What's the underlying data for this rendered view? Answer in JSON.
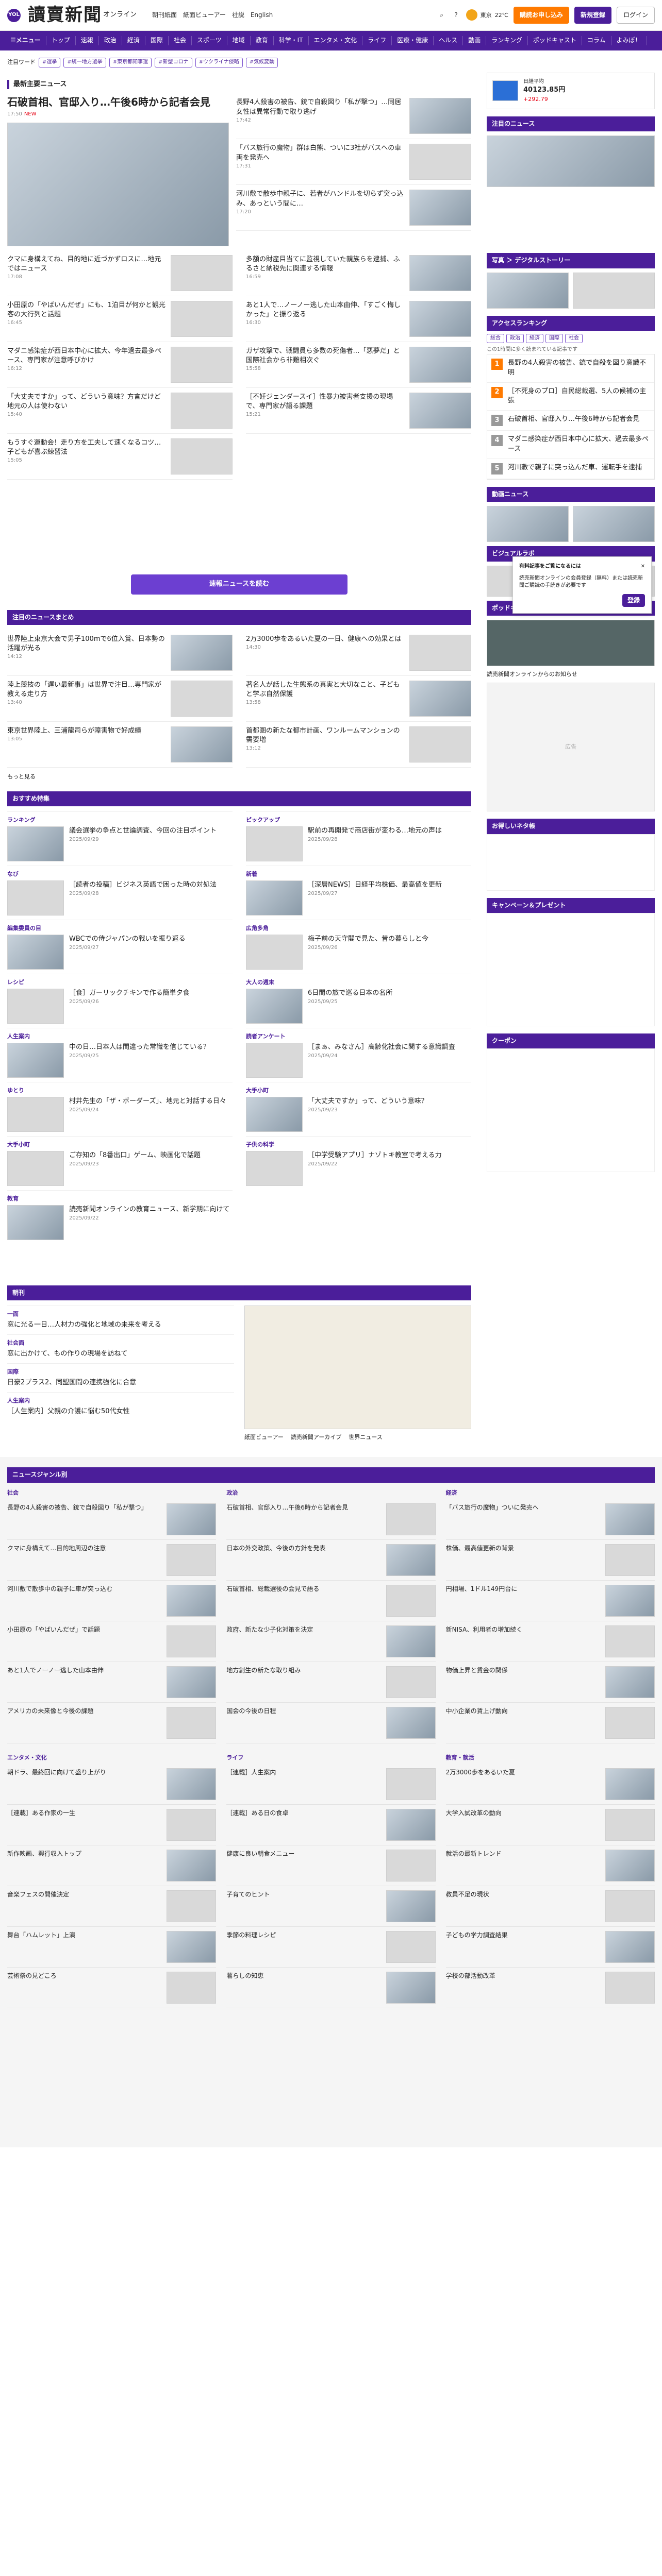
{
  "header": {
    "brand_badge": "YOL",
    "logo": "讀賣新聞",
    "logo_sub": "オンライン",
    "links": [
      "朝刊紙面",
      "紙面ビューアー",
      "社説",
      "English"
    ],
    "weather": {
      "city": "東京",
      "temp": "22℃"
    },
    "btn_subscribe": "購読お申し込み",
    "btn_register": "新規登録",
    "btn_login": "ログイン"
  },
  "nav": {
    "items": [
      "☰メニュー",
      "トップ",
      "速報",
      "政治",
      "経済",
      "国際",
      "社会",
      "スポーツ",
      "地域",
      "教育",
      "科学・IT",
      "エンタメ・文化",
      "ライフ",
      "医療・健康",
      "ヘルス",
      "動画",
      "ランキング",
      "ポッドキャスト",
      "コラム",
      "よみぽ！"
    ]
  },
  "trend": {
    "label": "注目ワード",
    "tags": [
      "#選挙",
      "#統一地方選挙",
      "#東京都知事選",
      "#新型コロナ",
      "#ウクライナ侵略",
      "#気候変動"
    ]
  },
  "main": {
    "section_title": "最新主要ニュース",
    "lead": {
      "title": "石破首相、官邸入り…午後6時から記者会見",
      "meta": "17:50",
      "new": "NEW"
    },
    "news": [
      {
        "title": "長野4人殺害の被告、銃で自殺図り「私が撃つ」…同居女性は異常行動で取り逃げ",
        "meta": "17:42"
      },
      {
        "title": "「バス旅行の魔物」群は白熊、ついに3社がバスへの車両を発売へ",
        "meta": "17:31"
      },
      {
        "title": "河川敷で散歩中親子に、若者がハンドルを切らず突っ込み、あっという間に…",
        "meta": "17:20"
      },
      {
        "title": "クマに身構えてね、目的地に近づかずロスに…地元ではニュース",
        "meta": "17:08"
      },
      {
        "title": "多額の財産目当てに監視していた親族らを逮捕、ふるさと納税先に関連する情報",
        "meta": "16:59"
      },
      {
        "title": "小田原の「やばいんだぜ」にも、1泊目が何かと観光客の大行列と話題",
        "meta": "16:45"
      },
      {
        "title": "あと1人で…ノーノー逃した山本由伸、「すごく悔しかった」と振り返る",
        "meta": "16:30"
      },
      {
        "title": "マダニ感染症が西日本中心に拡大、今年過去最多ペース、専門家が注意呼びかけ",
        "meta": "16:12"
      },
      {
        "title": "ガザ攻撃で、戦闘員ら多数の死傷者…「悪夢だ」と国際社会から非難相次ぐ",
        "meta": "15:58"
      },
      {
        "title": "「大丈夫ですか」って、どういう意味？方言だけど地元の人は使わない",
        "meta": "15:40"
      },
      {
        "title": "［不妊ジェンダースイ］性暴力被害者支援の現場で、専門家が語る課題",
        "meta": "15:21"
      },
      {
        "title": "もうすぐ運動会！走り方を工夫して速くなるコツ…子どもが喜ぶ練習法",
        "meta": "15:05"
      }
    ],
    "more_button": "速報ニュースを読む",
    "today_title": "注目のニュースまとめ",
    "today_left": [
      {
        "title": "世界陸上東京大会で男子100mで6位入賞、日本勢の活躍が光る",
        "meta": "14:12"
      },
      {
        "title": "陸上競技の「遅い最新事」は世界で注目…専門家が教える走り方",
        "meta": "13:40"
      },
      {
        "title": "東京世界陸上、三浦龍司らが障害物で好成績",
        "meta": "13:05"
      }
    ],
    "today_right": [
      {
        "title": "2万3000歩をあるいた夏の一日、健康への効果とは",
        "meta": "14:30"
      },
      {
        "title": "著名人が話した生態系の真実と大切なこと、子どもと学ぶ自然保護",
        "meta": "13:58"
      },
      {
        "title": "首都圏の新たな都市計画、ワンルームマンションの需要増",
        "meta": "13:12"
      }
    ],
    "reading": "もっと見る",
    "featured_title": "おすすめ特集",
    "cards": [
      {
        "cat": "ランキング",
        "title": "議会選挙の争点と世論調査、今回の注目ポイント",
        "meta": "2025/09/29"
      },
      {
        "cat": "ピックアップ",
        "title": "駅前の再開発で商店街が変わる…地元の声は",
        "meta": "2025/09/28"
      },
      {
        "cat": "なび",
        "title": "［読者の投稿］ビジネス英語で困った時の対処法",
        "meta": "2025/09/28"
      },
      {
        "cat": "新着",
        "title": "［深層NEWS］日経平均株価、最高値を更新",
        "meta": "2025/09/27"
      },
      {
        "cat": "編集委員の目",
        "title": "WBCでの侍ジャパンの戦いを振り返る",
        "meta": "2025/09/27"
      },
      {
        "cat": "広角多角",
        "title": "梅子前の天守閣で見た、昔の暮らしと今",
        "meta": "2025/09/26"
      },
      {
        "cat": "レシピ",
        "title": "［食］ガーリックチキンで作る簡単夕食",
        "meta": "2025/09/26"
      },
      {
        "cat": "大人の週末",
        "title": "6日間の旅で巡る日本の名所",
        "meta": "2025/09/25"
      },
      {
        "cat": "人生案内",
        "title": "中の日…日本人は間違った常識を信じている？",
        "meta": "2025/09/25"
      },
      {
        "cat": "読者アンケート",
        "title": "［まぁ、みなさん］高齢化社会に関する意識調査",
        "meta": "2025/09/24"
      },
      {
        "cat": "ゆとり",
        "title": "村井先生の「ザ・ボーダーズ」、地元と対話する日々",
        "meta": "2025/09/24"
      },
      {
        "cat": "大手小町",
        "title": "「大丈夫ですか」って、どういう意味？",
        "meta": "2025/09/23"
      },
      {
        "cat": "大手小町",
        "title": "ご存知の「8番出口」ゲーム、映画化で話題",
        "meta": "2025/09/23"
      },
      {
        "cat": "子供の科学",
        "title": "［中学受験アプリ］ナゾトキ教室で考える力",
        "meta": "2025/09/22"
      },
      {
        "cat": "教育",
        "title": "読売新聞オンラインの教育ニュース、新学期に向けて",
        "meta": "2025/09/22"
      }
    ],
    "column_title": "朝刊",
    "column_items": [
      {
        "cat": "一面",
        "title": "窓に光る一日…人材力の強化と地域の未来を考える"
      },
      {
        "cat": "社会面",
        "title": "窓に出かけて、もの作りの現場を訪ねて"
      },
      {
        "cat": "国際",
        "title": "日豪2プラス2、同盟国間の連携強化に合意"
      },
      {
        "cat": "人生案内",
        "title": "［人生案内］父親の介護に悩む50代女性"
      }
    ],
    "column_links": [
      "紙面ビューアー",
      "読売新聞アーカイブ",
      "世界ニュース"
    ],
    "genre_title": "ニュースジャンル別"
  },
  "side": {
    "market": {
      "label": "日経平均",
      "value": "40123.85円",
      "change": "+292.79"
    },
    "chart_label": "日経平均",
    "todays_title": "注目のニュース",
    "photo_title": "写真 ＞ デジタルストーリー",
    "access_title": "アクセスランキング",
    "access_tabs": [
      "総合",
      "政治",
      "経済",
      "国際",
      "社会"
    ],
    "access_note": "この1時間に多く読まれている記事です",
    "ranks": [
      "長野の4人殺害の被告、銃で自殺を図り意識不明",
      "［不死身のプロ］自民総裁選、5人の候補の主張",
      "石破首相、官邸入り…午後6時から記者会見",
      "マダニ感染症が西日本中心に拡大、過去最多ペース",
      "河川敷で親子に突っ込んだ車、運転手を逮捕"
    ],
    "popup": {
      "title": "有料記事をご覧になるには",
      "text": "読売新聞オンラインの会員登録（無料）または読売新聞ご購読の手続きが必要です",
      "btn": "登録"
    },
    "video_title": "動画ニュース",
    "visual_title": "ビジュアルラボ",
    "podcast_title": "ポッドキャスト",
    "ad_label": "広告",
    "bus_title": "お得しいネタ帳",
    "campaign_title": "キャンペーン＆プレゼント",
    "coupon_title": "クーポン",
    "latest_label": "読売新聞オンラインからのお知らせ"
  },
  "footer": {
    "groups": [
      {
        "title": "社会",
        "items": [
          "長野の4人殺害の被告、銃で自殺図り「私が撃つ」",
          "クマに身構えて…目的地周辺の注意",
          "河川敷で散歩中の親子に車が突っ込む",
          "小田原の「やばいんだぜ」で話題",
          "あと1人でノーノー逃した山本由伸",
          "アメリカの未来像と今後の課題"
        ]
      },
      {
        "title": "政治",
        "items": [
          "石破首相、官邸入り…午後6時から記者会見",
          "日本の外交政策、今後の方針を発表",
          "石破首相、総裁選後の会見で語る",
          "政府、新たな少子化対策を決定",
          "地方創生の新たな取り組み",
          "国会の今後の日程"
        ]
      },
      {
        "title": "経済",
        "items": [
          "「バス旅行の魔物」ついに発売へ",
          "株価、最高値更新の背景",
          "円相場、1ドル149円台に",
          "新NISA、利用者の増加続く",
          "物価上昇と賃金の関係",
          "中小企業の賃上げ動向"
        ]
      }
    ],
    "groups2": [
      {
        "title": "エンタメ・文化",
        "items": [
          "朝ドラ、最終回に向けて盛り上がり",
          "［連載］ある作家の一生",
          "新作映画、興行収入トップ",
          "音楽フェスの開催決定",
          "舞台「ハムレット」上演",
          "芸術祭の見どころ"
        ]
      },
      {
        "title": "ライフ",
        "items": [
          "［連載］人生案内",
          "［連載］ある日の食卓",
          "健康に良い朝食メニュー",
          "子育てのヒント",
          "季節の料理レシピ",
          "暮らしの知恵"
        ]
      },
      {
        "title": "教育・就活",
        "items": [
          "2万3000歩をあるいた夏",
          "大学入試改革の動向",
          "就活の最新トレンド",
          "教員不足の現状",
          "子どもの学力調査結果",
          "学校の部活動改革"
        ]
      }
    ]
  }
}
